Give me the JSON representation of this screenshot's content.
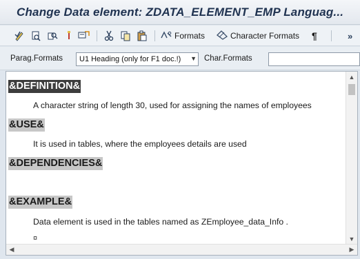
{
  "window": {
    "title": "Change Data element: ZDATA_ELEMENT_EMP Languag..."
  },
  "toolbar": {
    "formats_label": "Formats",
    "char_formats_label": "Character Formats",
    "paragraph_mark": "¶",
    "more": "»"
  },
  "format_bar": {
    "parag_label": "Parag.Formats",
    "parag_value": "U1 Heading (only for F1 doc.!)",
    "char_label": "Char.Formats",
    "char_value": ""
  },
  "document": {
    "definition_heading": "&DEFINITION&",
    "definition_text": "A character string of length 30, used for assigning the names of employees",
    "use_heading": "&USE&",
    "use_text": "It is used in tables, where the employees details are used",
    "dependencies_heading": "&DEPENDENCIES&",
    "example_heading": "&EXAMPLE&",
    "example_text": "Data element is used in the tables named as ZEmployee_data_Info .",
    "end_mark": "¤"
  },
  "colors": {
    "title_text": "#1f3250",
    "heading_highlight": "#c7c7c7",
    "heading_selected": "#3d3d3d"
  }
}
